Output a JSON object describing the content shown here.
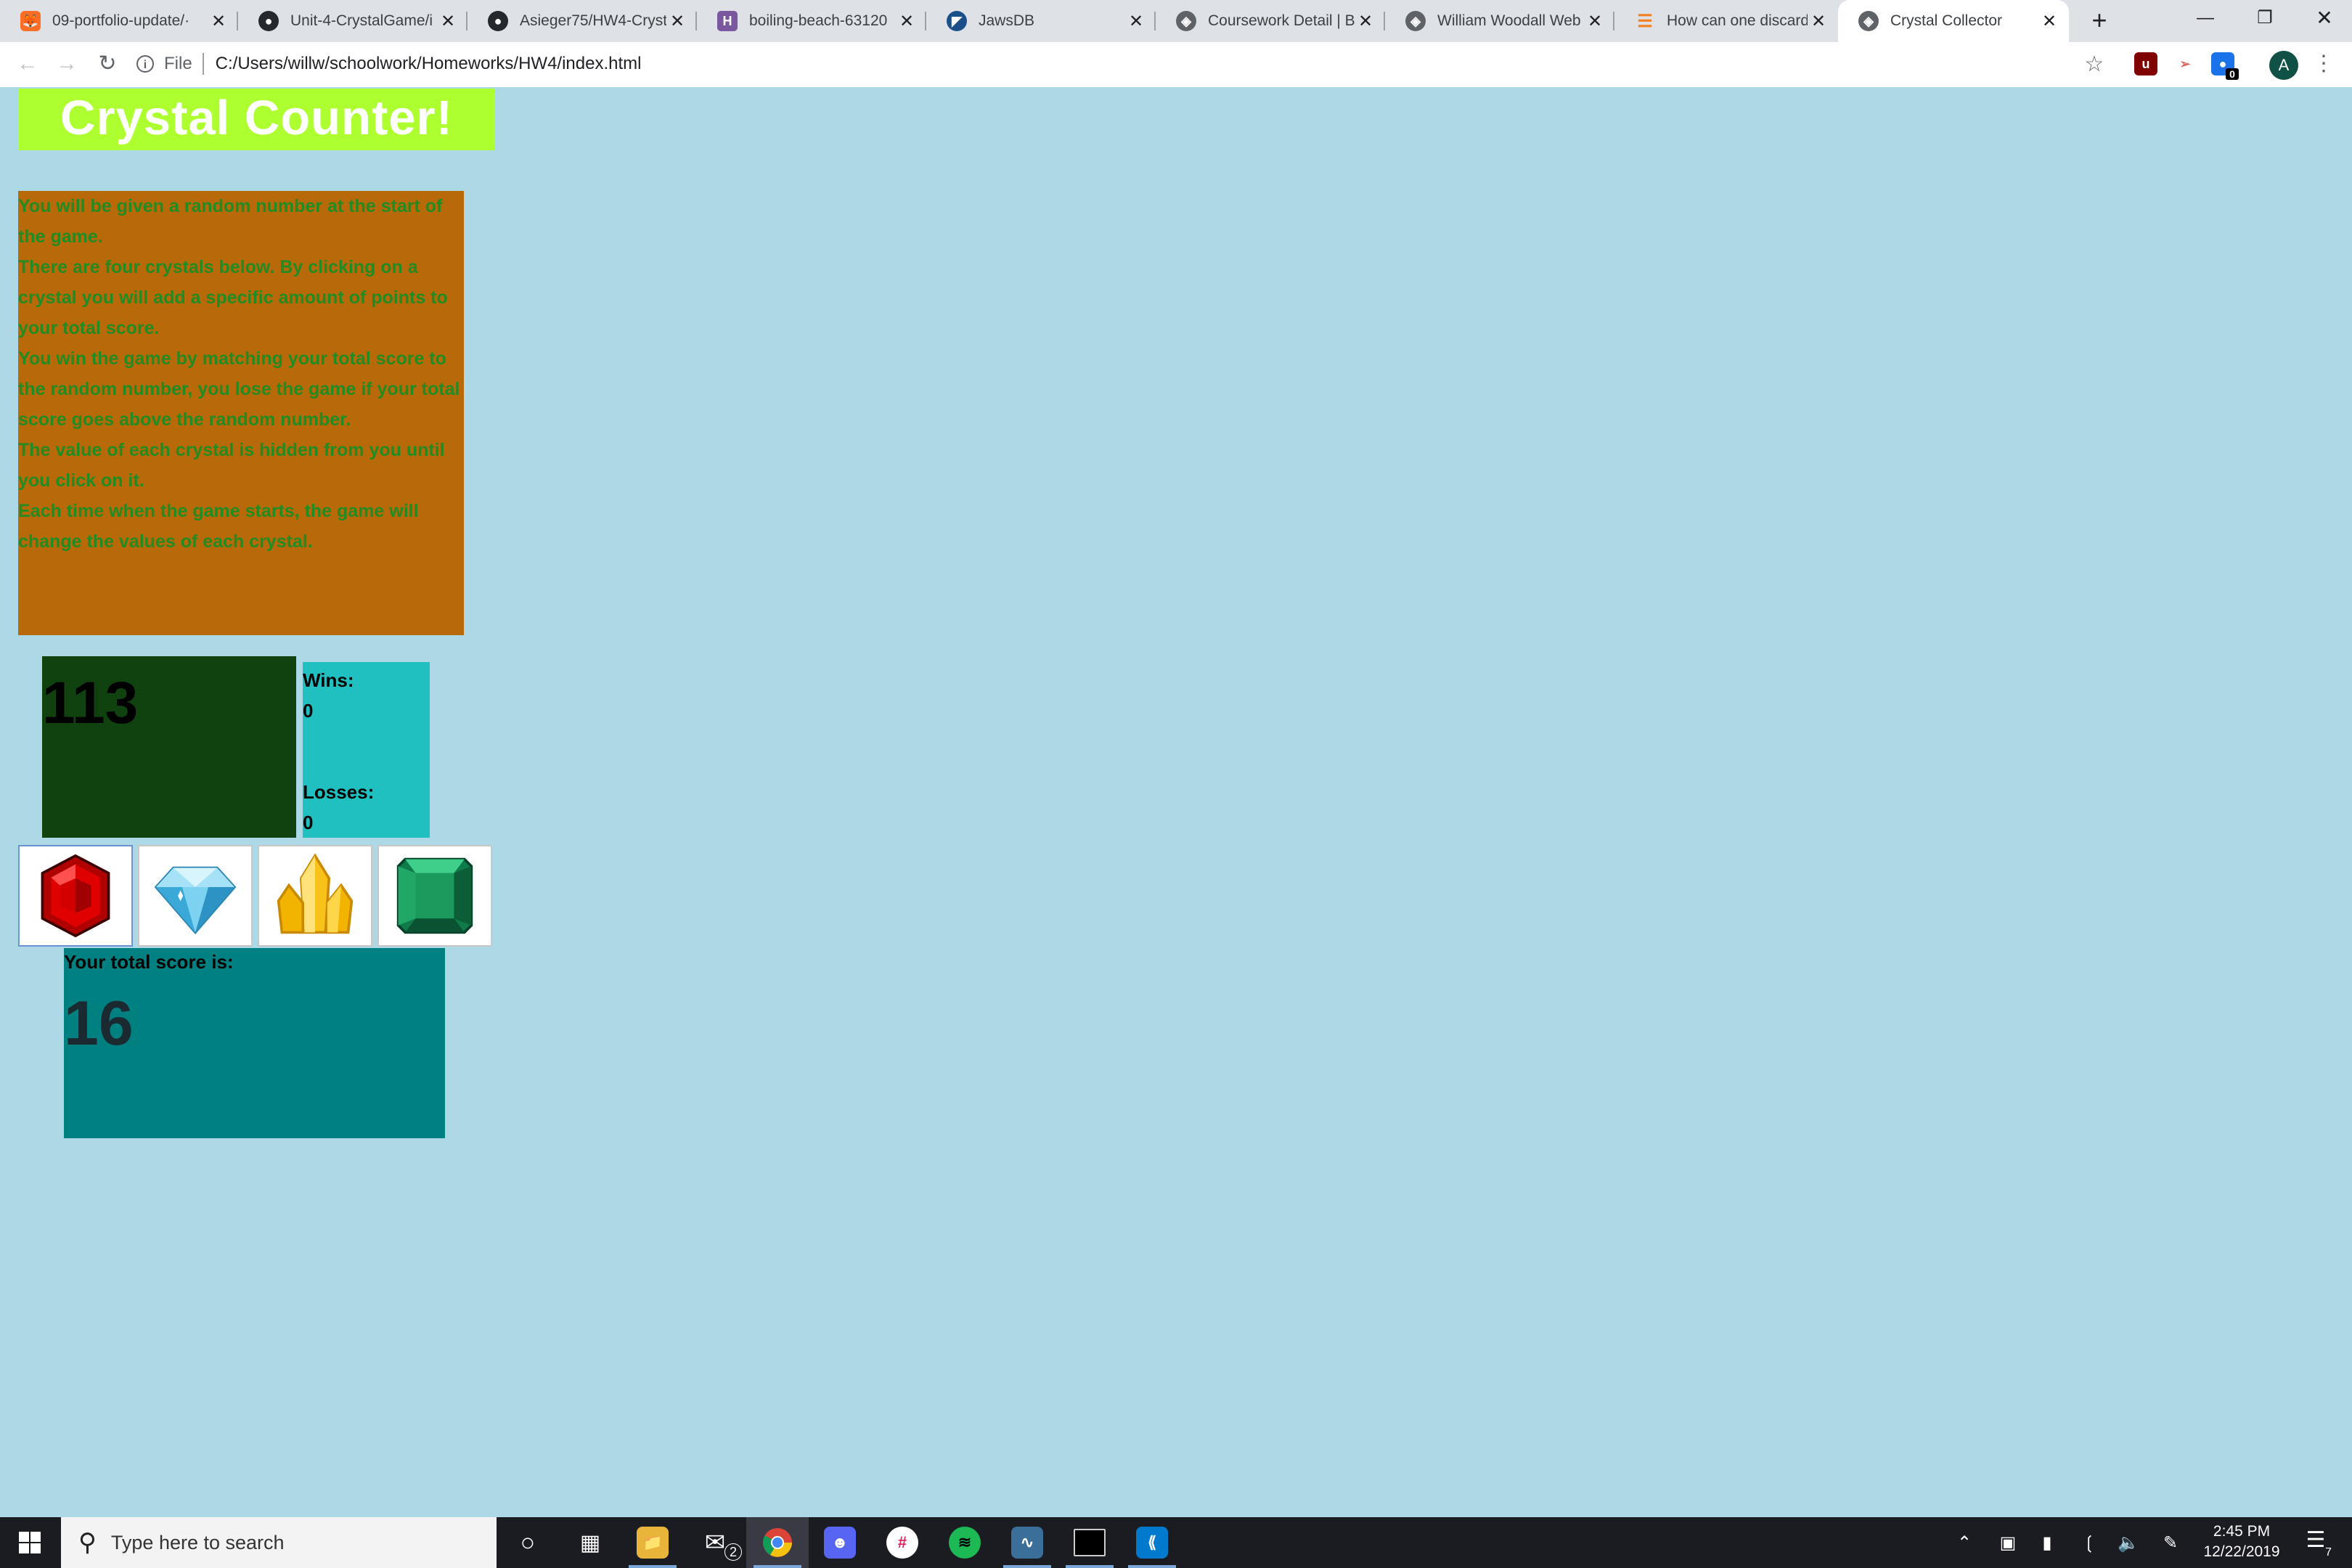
{
  "browser": {
    "tabs": [
      {
        "title": "09-portfolio-update/·",
        "icon": "gitlab-icon",
        "color": "#e24329"
      },
      {
        "title": "Unit-4-CrystalGame/i",
        "icon": "github-icon",
        "color": "#24292e"
      },
      {
        "title": "Asieger75/HW4-Cryst",
        "icon": "github-icon",
        "color": "#24292e"
      },
      {
        "title": "boiling-beach-63120",
        "icon": "heroku-icon",
        "color": "#79589f"
      },
      {
        "title": "JawsDB",
        "icon": "jawsdb-icon",
        "color": "#1a4f8a"
      },
      {
        "title": "Coursework Detail | B",
        "icon": "globe-icon",
        "color": "#5f6368"
      },
      {
        "title": "William Woodall Web",
        "icon": "globe-icon",
        "color": "#5f6368"
      },
      {
        "title": "How can one discard",
        "icon": "stackoverflow-icon",
        "color": "#f48024"
      },
      {
        "title": "Crystal Collector",
        "icon": "globe-icon",
        "color": "#5f6368"
      }
    ],
    "address": {
      "scheme_label": "File",
      "url": "C:/Users/willw/schoolwork/Homeworks/HW4/index.html"
    },
    "profile_initial": "A",
    "extension_badge": "0"
  },
  "page": {
    "title": "Crystal Counter!",
    "instructions": [
      "You will be given a random number at the start of the game.",
      "There are four crystals below. By clicking on a crystal you will add a specific amount of points to your total score.",
      "You win the game by matching your total score to the random number, you lose the game if your total score goes above the random number.",
      "The value of each crystal is hidden from you until you click on it.",
      "Each time when the game starts, the game will change the values of each crystal."
    ],
    "target_number": "113",
    "wins_label": "Wins:",
    "wins": "0",
    "losses_label": "Losses:",
    "losses": "0",
    "crystals": [
      "ruby-crystal",
      "diamond-crystal",
      "citrine-crystal",
      "emerald-crystal"
    ],
    "score_label": "Your total score is:",
    "score": "16"
  },
  "taskbar": {
    "search_placeholder": "Type here to search",
    "mail_badge": "2",
    "time": "2:45 PM",
    "date": "12/22/2019",
    "notification_count": "7"
  },
  "colors": {
    "page_bg": "#add8e6",
    "title_bg": "#adff2f",
    "instructions_bg": "#b8690a",
    "instructions_text": "#228b22",
    "target_bg": "#10420f",
    "winloss_bg": "#20c0c0",
    "score_bg": "#008080"
  }
}
